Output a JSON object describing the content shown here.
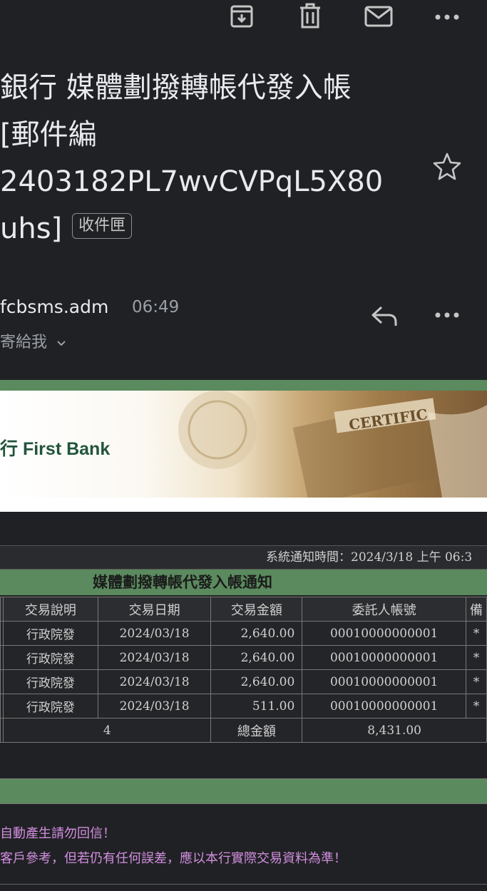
{
  "toolbar": {
    "archive_icon": "archive-icon",
    "delete_icon": "trash-icon",
    "mark_icon": "mail-icon",
    "more_icon": "more-vert-icon"
  },
  "email": {
    "subject_lines": [
      "銀行 媒體劃撥轉帳代發入帳",
      "[郵件編",
      "2403182PL7wvCVPqL5X80",
      "uhs]"
    ],
    "label_badge": "收件匣",
    "sender": "fcbsms.adm",
    "time": "06:49",
    "recipient": "寄給我"
  },
  "banner": {
    "bank_name": "First Bank",
    "bank_char": "行"
  },
  "notice": {
    "time_label": "系統通知時間：2024/3/18 上午 06:3",
    "title": "媒體劃撥轉帳代發入帳通知",
    "headers": [
      "交易說明",
      "交易日期",
      "交易金額",
      "委託人帳號",
      "備"
    ],
    "rows": [
      {
        "desc": "行政院發",
        "date": "2024/03/18",
        "amount": "2,640.00",
        "account": "00010000000001",
        "note": "*"
      },
      {
        "desc": "行政院發",
        "date": "2024/03/18",
        "amount": "2,640.00",
        "account": "00010000000001",
        "note": "*"
      },
      {
        "desc": "行政院發",
        "date": "2024/03/18",
        "amount": "2,640.00",
        "account": "00010000000001",
        "note": "*"
      },
      {
        "desc": "行政院發",
        "date": "2024/03/18",
        "amount": "511.00",
        "account": "00010000000001",
        "note": "*"
      }
    ],
    "count": "4",
    "total_label": "總金額",
    "total": "8,431.00"
  },
  "footer": {
    "line1": "自動產生請勿回信！",
    "line2": "客戶參考，但若仍有任何誤差，應以本行實際交易資料為準！"
  },
  "colors": {
    "background": "#202124",
    "bank_green": "#5a8a5e",
    "footer_text": "#d28fe0"
  }
}
